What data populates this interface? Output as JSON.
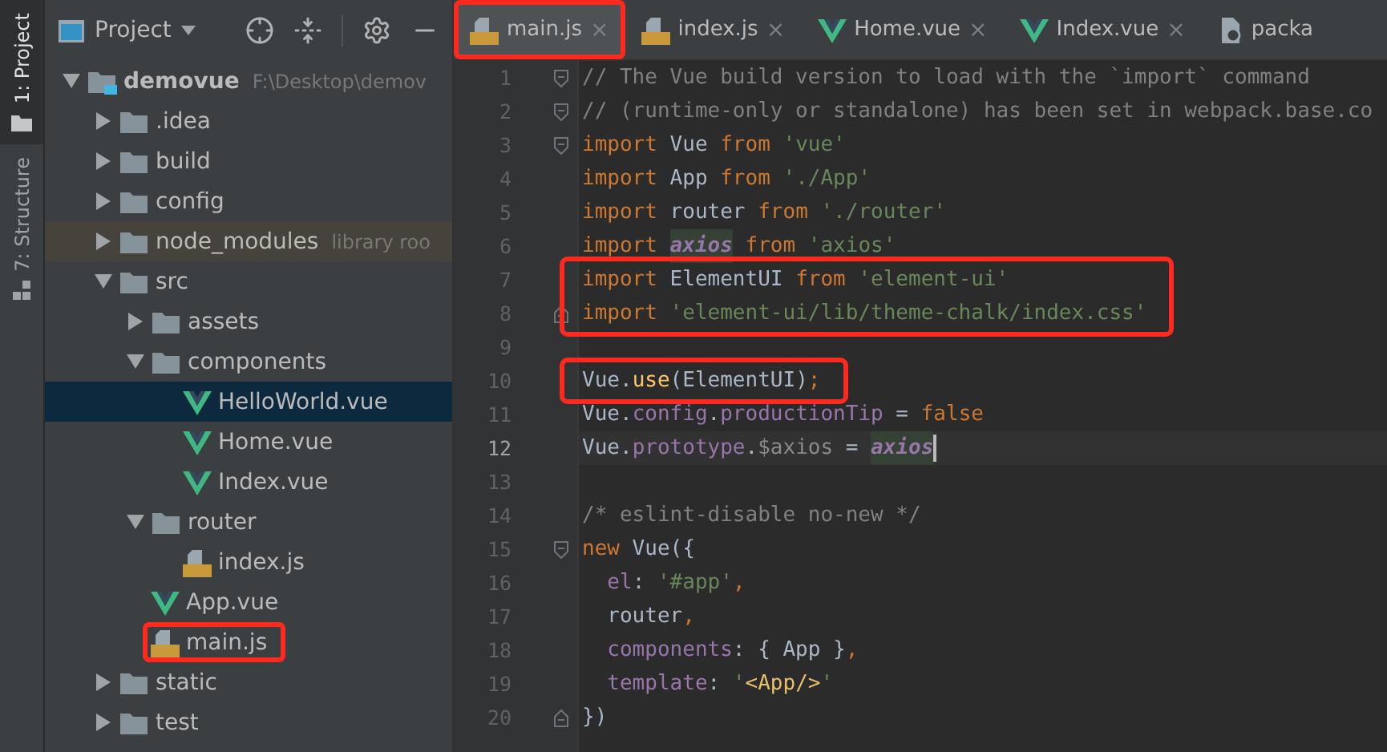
{
  "side_strip": [
    {
      "label": "1: Project",
      "selected": true,
      "kind": "project"
    },
    {
      "label": "7: Structure",
      "selected": false,
      "kind": "structure"
    }
  ],
  "project_panel": {
    "title": "Project",
    "tree": [
      {
        "label": "demovue",
        "hint": "F:\\Desktop\\demov",
        "kind": "module",
        "expanded": true,
        "selected": false,
        "boxed": false,
        "children": [
          {
            "label": ".idea",
            "kind": "folder",
            "expanded": false,
            "selected": false,
            "boxed": false
          },
          {
            "label": "build",
            "kind": "folder",
            "expanded": false,
            "selected": false,
            "boxed": false
          },
          {
            "label": "config",
            "kind": "folder",
            "expanded": false,
            "selected": false,
            "boxed": false
          },
          {
            "label": "node_modules",
            "hint": "library roo",
            "kind": "folder",
            "expanded": false,
            "selected": false,
            "boxed": false
          },
          {
            "label": "src",
            "kind": "folder",
            "expanded": true,
            "selected": false,
            "boxed": false,
            "children": [
              {
                "label": "assets",
                "kind": "folder",
                "expanded": false,
                "selected": false,
                "boxed": false
              },
              {
                "label": "components",
                "kind": "folder",
                "expanded": true,
                "selected": false,
                "boxed": false,
                "children": [
                  {
                    "label": "HelloWorld.vue",
                    "kind": "vue",
                    "selected": true,
                    "boxed": false
                  },
                  {
                    "label": "Home.vue",
                    "kind": "vue",
                    "selected": false,
                    "boxed": false
                  },
                  {
                    "label": "Index.vue",
                    "kind": "vue",
                    "selected": false,
                    "boxed": false
                  }
                ]
              },
              {
                "label": "router",
                "kind": "folder",
                "expanded": true,
                "selected": false,
                "boxed": false,
                "children": [
                  {
                    "label": "index.js",
                    "kind": "js",
                    "selected": false,
                    "boxed": false
                  }
                ]
              },
              {
                "label": "App.vue",
                "kind": "vue",
                "selected": false,
                "boxed": false
              },
              {
                "label": "main.js",
                "kind": "js",
                "selected": false,
                "boxed": true
              }
            ]
          },
          {
            "label": "static",
            "kind": "folder",
            "expanded": false,
            "selected": false,
            "boxed": false
          },
          {
            "label": "test",
            "kind": "folder",
            "expanded": false,
            "selected": false,
            "boxed": false
          }
        ]
      }
    ]
  },
  "tabs": [
    {
      "label": "main.js",
      "kind": "js",
      "selected": true,
      "close": "×",
      "boxed": true
    },
    {
      "label": "index.js",
      "kind": "js",
      "selected": false,
      "close": "×",
      "boxed": false
    },
    {
      "label": "Home.vue",
      "kind": "vue",
      "selected": false,
      "close": "×",
      "boxed": false
    },
    {
      "label": "Index.vue",
      "kind": "vue",
      "selected": false,
      "close": "×",
      "boxed": false
    },
    {
      "label": "packa",
      "kind": "json",
      "selected": false,
      "boxed": false
    }
  ],
  "code_lines": [
    {
      "number": "1",
      "fold": {
        "kind": "start"
      },
      "boxed": false,
      "current": false,
      "tokens": [
        {
          "kind": "comment",
          "text": "// The Vue build version to load with the `import` command"
        }
      ]
    },
    {
      "number": "2",
      "fold": {
        "kind": "start"
      },
      "boxed": false,
      "current": false,
      "tokens": [
        {
          "kind": "comment",
          "text": "// (runtime-only or standalone) has been set in webpack.base.co"
        }
      ]
    },
    {
      "number": "3",
      "fold": {
        "kind": "start"
      },
      "boxed": false,
      "current": false,
      "tokens": [
        {
          "kind": "keyword",
          "text": "import"
        },
        {
          "kind": "plain",
          "text": " Vue "
        },
        {
          "kind": "keyword",
          "text": "from"
        },
        {
          "kind": "string",
          "text": " 'vue'"
        }
      ]
    },
    {
      "number": "4",
      "boxed": false,
      "current": false,
      "tokens": [
        {
          "kind": "keyword",
          "text": "import"
        },
        {
          "kind": "plain",
          "text": " App "
        },
        {
          "kind": "keyword",
          "text": "from"
        },
        {
          "kind": "string",
          "text": " './App'"
        }
      ]
    },
    {
      "number": "5",
      "boxed": false,
      "current": false,
      "tokens": [
        {
          "kind": "keyword",
          "text": "import"
        },
        {
          "kind": "plain",
          "text": " router "
        },
        {
          "kind": "keyword",
          "text": "from"
        },
        {
          "kind": "string",
          "text": " './router'"
        }
      ]
    },
    {
      "number": "6",
      "boxed": false,
      "current": false,
      "tokens": [
        {
          "kind": "keyword",
          "text": "import "
        },
        {
          "kind": "unused",
          "text": "axios"
        },
        {
          "kind": "keyword",
          "text": " from"
        },
        {
          "kind": "string",
          "text": " 'axios'"
        }
      ]
    },
    {
      "number": "7",
      "boxed": true,
      "current": false,
      "tokens": [
        {
          "kind": "keyword",
          "text": "import"
        },
        {
          "kind": "plain",
          "text": " ElementUI "
        },
        {
          "kind": "keyword",
          "text": "from"
        },
        {
          "kind": "string",
          "text": " 'element-ui'"
        }
      ]
    },
    {
      "number": "8",
      "fold": {
        "kind": "end"
      },
      "boxed": true,
      "current": false,
      "tokens": [
        {
          "kind": "keyword",
          "text": "import"
        },
        {
          "kind": "string",
          "text": " 'element-ui/lib/theme-chalk/index.css'"
        }
      ]
    },
    {
      "number": "9",
      "boxed": false,
      "current": false
    },
    {
      "number": "10",
      "boxed": true,
      "current": false,
      "tokens": [
        {
          "kind": "plain",
          "text": "Vue."
        },
        {
          "kind": "function",
          "text": "use"
        },
        {
          "kind": "plain",
          "text": "(ElementUI)"
        },
        {
          "kind": "keyword",
          "text": ";"
        }
      ]
    },
    {
      "number": "11",
      "boxed": false,
      "current": false,
      "tokens": [
        {
          "kind": "plain",
          "text": "Vue."
        },
        {
          "kind": "property",
          "text": "config"
        },
        {
          "kind": "plain",
          "text": "."
        },
        {
          "kind": "property",
          "text": "productionTip"
        },
        {
          "kind": "plain",
          "text": " = "
        },
        {
          "kind": "keyword",
          "text": "false"
        }
      ]
    },
    {
      "number": "12",
      "boxed": false,
      "current": true,
      "tokens": [
        {
          "kind": "plain",
          "text": "Vue."
        },
        {
          "kind": "property",
          "text": "prototype"
        },
        {
          "kind": "plain",
          "text": "."
        },
        {
          "kind": "muted",
          "text": "$axios"
        },
        {
          "kind": "plain",
          "text": " = "
        },
        {
          "kind": "global",
          "text": "axios"
        }
      ]
    },
    {
      "number": "13",
      "boxed": false,
      "current": false
    },
    {
      "number": "14",
      "boxed": false,
      "current": false,
      "tokens": [
        {
          "kind": "comment",
          "text": "/* eslint-disable no-new */"
        }
      ]
    },
    {
      "number": "15",
      "fold": {
        "kind": "start"
      },
      "boxed": false,
      "current": false,
      "tokens": [
        {
          "kind": "keyword",
          "text": "new"
        },
        {
          "kind": "plain",
          "text": " Vue({"
        }
      ]
    },
    {
      "number": "16",
      "boxed": false,
      "current": false,
      "tokens": [
        {
          "kind": "property",
          "text": "  el"
        },
        {
          "kind": "plain",
          "text": ": "
        },
        {
          "kind": "string",
          "text": "'#app'"
        },
        {
          "kind": "keyword",
          "text": ","
        }
      ]
    },
    {
      "number": "17",
      "boxed": false,
      "current": false,
      "tokens": [
        {
          "kind": "plain",
          "text": "  router"
        },
        {
          "kind": "keyword",
          "text": ","
        }
      ]
    },
    {
      "number": "18",
      "boxed": false,
      "current": false,
      "tokens": [
        {
          "kind": "property",
          "text": "  components"
        },
        {
          "kind": "plain",
          "text": ": { App }"
        },
        {
          "kind": "keyword",
          "text": ","
        }
      ]
    },
    {
      "number": "19",
      "boxed": false,
      "current": false,
      "tokens": [
        {
          "kind": "property",
          "text": "  template"
        },
        {
          "kind": "plain",
          "text": ": "
        },
        {
          "kind": "string",
          "text": "'"
        },
        {
          "kind": "tag",
          "text": "<App/>"
        },
        {
          "kind": "string",
          "text": "'"
        }
      ]
    },
    {
      "number": "20",
      "fold": {
        "kind": "end"
      },
      "boxed": false,
      "current": false,
      "tokens": [
        {
          "kind": "plain",
          "text": "})"
        }
      ]
    }
  ]
}
